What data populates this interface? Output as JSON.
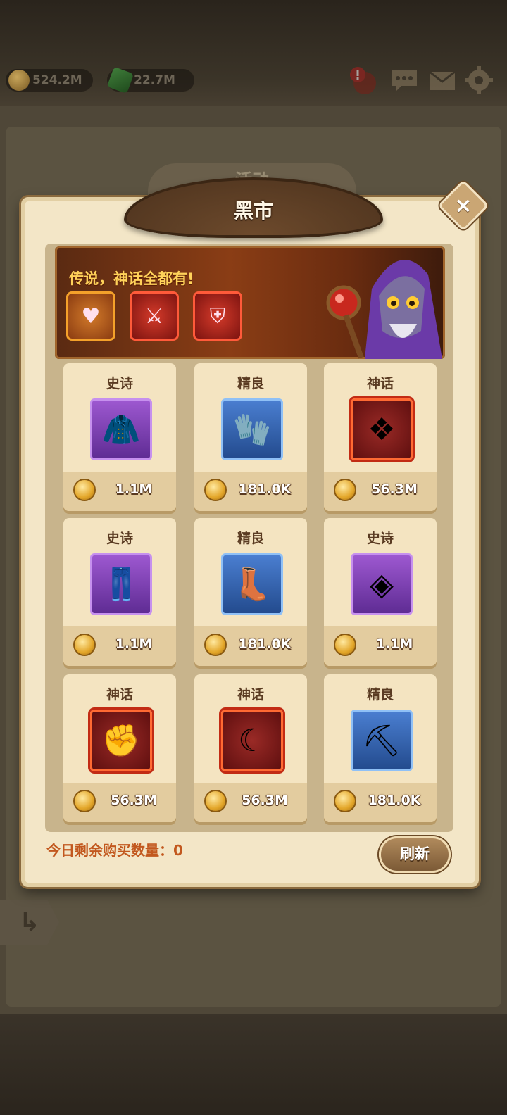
{
  "resources": {
    "gold": "524.2M",
    "gems": "22.7M"
  },
  "top_icons": [
    "alert-icon",
    "chat-icon",
    "mail-icon",
    "gear-icon"
  ],
  "background_tab": "活动",
  "panel": {
    "title": "黑市",
    "close_label": "×"
  },
  "banner": {
    "slogan": "传说，神话全都有!"
  },
  "shop_items": [
    {
      "rarity": "史诗",
      "price": "1.1M",
      "item": "cloak-icon"
    },
    {
      "rarity": "精良",
      "price": "181.0K",
      "item": "gloves-icon"
    },
    {
      "rarity": "神话",
      "price": "56.3M",
      "item": "amulet-icon"
    },
    {
      "rarity": "史诗",
      "price": "1.1M",
      "item": "leggings-icon"
    },
    {
      "rarity": "精良",
      "price": "181.0K",
      "item": "boots-icon"
    },
    {
      "rarity": "史诗",
      "price": "1.1M",
      "item": "necklace-icon"
    },
    {
      "rarity": "神话",
      "price": "56.3M",
      "item": "gauntlet-icon"
    },
    {
      "rarity": "神话",
      "price": "56.3M",
      "item": "blade-icon"
    },
    {
      "rarity": "精良",
      "price": "181.0K",
      "item": "pickaxe-icon"
    }
  ],
  "footer": {
    "remaining_purchases": "今日剩余购买数量：0",
    "refresh_label": "刷新"
  },
  "colors": {
    "epic": "#9d58d0",
    "fine": "#4a7ed0",
    "myth": "#9a2a26",
    "accent_text": "#c2581e"
  }
}
